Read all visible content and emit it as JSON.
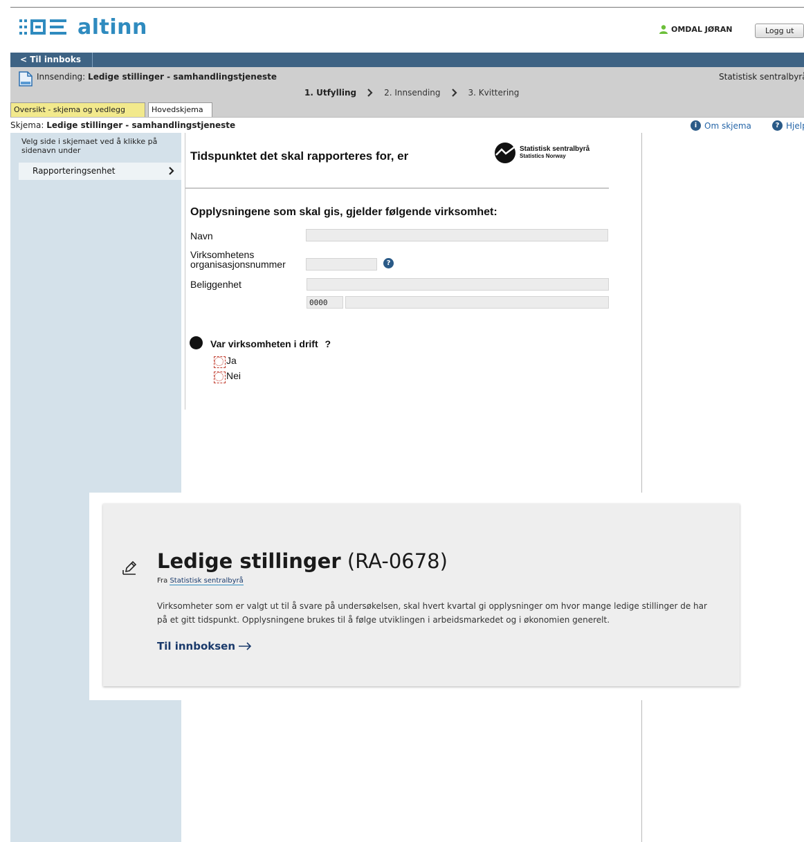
{
  "header": {
    "logo_text": "altinn",
    "user_name": "OMDAL JØRAN",
    "logout_label": "Logg ut"
  },
  "nav": {
    "back_label": "< Til innboks"
  },
  "submission": {
    "prefix": "Innsending:",
    "title": "Ledige stillinger - samhandlingstjeneste",
    "organization": "Statistisk sentralbyrå",
    "steps": [
      "1. Utfylling",
      "2. Innsending",
      "3. Kvittering"
    ],
    "active_step": 0
  },
  "tabs": [
    {
      "label": "Oversikt - skjema og vedlegg"
    },
    {
      "label": "Hovedskjema"
    }
  ],
  "schema": {
    "prefix": "Skjema:",
    "title": "Ledige stillinger - samhandlingstjeneste",
    "about_label": "Om skjema",
    "help_label": "Hjelp"
  },
  "sidebar": {
    "help_text": "Velg side i skjemaet ved å klikke på sidenavn under",
    "items": [
      {
        "label": "Rapporteringsenhet"
      }
    ]
  },
  "form": {
    "title": "Tidspunktet det skal rapporteres for, er",
    "ssb_logo": {
      "line1": "Statistisk sentralbyrå",
      "line2": "Statistics Norway"
    },
    "section_title": "Opplysningene som skal gis, gjelder følgende virksomhet:",
    "fields": {
      "name_label": "Navn",
      "orgnr_label": "Virksomhetens organisasjonsnummer",
      "location_label": "Beliggenhet",
      "postal_code": "0000"
    },
    "question": "Var virksomheten i drift",
    "question_mark": "?",
    "options": [
      "Ja",
      "Nei"
    ]
  },
  "card": {
    "title_bold": "Ledige stillinger",
    "code": "(RA-0678)",
    "from_prefix": "Fra",
    "from_link": "Statistisk sentralbyrå",
    "description": "Virksomheter som er valgt ut til å svare på undersøkelsen, skal hvert kvartal gi opplysninger om hvor mange ledige stillinger de har på et gitt tidspunkt. Opplysningene brukes til å følge utviklingen i arbeidsmarkedet og i økonomien generelt.",
    "link_label": "Til innboksen"
  },
  "colors": {
    "brand_blue": "#2f8bbf",
    "nav_bar": "#3e6384",
    "sidebar_bg": "#d4e1ea",
    "tab_highlight": "#f2e98c"
  }
}
